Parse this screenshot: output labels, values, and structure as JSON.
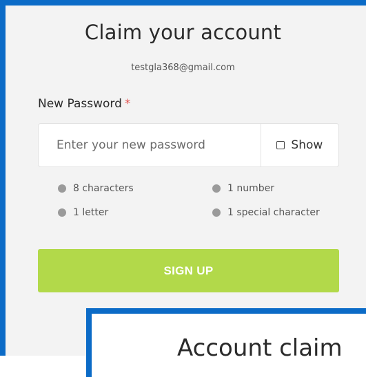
{
  "form": {
    "title": "Claim your account",
    "email": "testgla368@gmail.com",
    "password_label": "New Password",
    "required_marker": "*",
    "password_placeholder": "Enter your new password",
    "password_value": "",
    "show_label": "Show",
    "show_checked": false,
    "requirements": [
      {
        "label": "8 characters",
        "met": false
      },
      {
        "label": "1 number",
        "met": false
      },
      {
        "label": "1 letter",
        "met": false
      },
      {
        "label": "1 special character",
        "met": false
      }
    ],
    "submit_label": "SIGN UP"
  },
  "overlay": {
    "title": "Account claim"
  },
  "colors": {
    "frame_border": "#0b6bc7",
    "submit_bg": "#b2d94a",
    "required": "#e3524f",
    "requirement_dot": "#9a9a9a"
  }
}
